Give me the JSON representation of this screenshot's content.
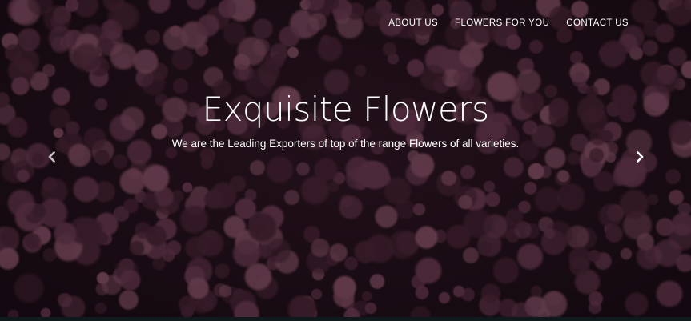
{
  "nav": {
    "items": [
      {
        "label": "ABOUT US"
      },
      {
        "label": "FLOWERS FOR YOU"
      },
      {
        "label": "CONTACT US"
      }
    ]
  },
  "hero": {
    "title": "Exquisite Flowers",
    "subtitle": "We are the Leading Exporters of top of the range Flowers of all varieties."
  },
  "carousel": {
    "prev_icon": "chevron-left-icon",
    "next_icon": "chevron-right-icon"
  },
  "colors": {
    "text": "#ffffff",
    "flower_dark": "#4a2636",
    "flower_mid": "#6e3d53",
    "flower_light": "#8a5469",
    "background": "#2a1520",
    "bottom_strip": "#0f1a1c"
  }
}
